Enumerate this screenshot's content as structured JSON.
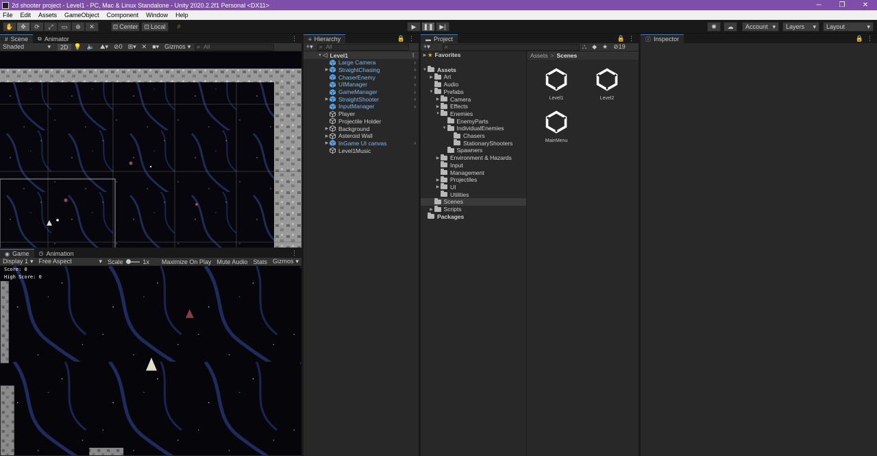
{
  "window": {
    "title": "2d shooter project - Level1 - PC, Mac & Linux Standalone - Unity 2020.2.2f1 Personal <DX11>",
    "controls": [
      "─",
      "❐",
      "✕"
    ]
  },
  "menu": [
    "File",
    "Edit",
    "Assets",
    "GameObject",
    "Component",
    "Window",
    "Help"
  ],
  "toolbar": {
    "tools": [
      "✋",
      "✥",
      "⟳",
      "⤢",
      "▭",
      "⊕",
      "✕"
    ],
    "pivot_label": "Center",
    "space_label": "Local",
    "snap_icon": "#",
    "play": "▶",
    "pause": "❚❚",
    "step": "▶|",
    "account_label": "Account",
    "layers_label": "Layers",
    "layout_label": "Layout"
  },
  "scene_panel": {
    "tabs": [
      "Scene",
      "Animator"
    ],
    "shading": "Shaded",
    "mode_2d": "2D",
    "fx_count": "0",
    "gizmos": "Gizmos",
    "search_placeholder": "All"
  },
  "game_panel": {
    "tabs": [
      "Game",
      "Animation"
    ],
    "display": "Display 1",
    "aspect": "Free Aspect",
    "scale_label": "Scale",
    "scale_value": "1x",
    "maximize": "Maximize On Play",
    "mute": "Mute Audio",
    "stats": "Stats",
    "gizmos": "Gizmos",
    "score_text": "Score: 0",
    "high_score_text": "High Score: 0"
  },
  "hierarchy": {
    "tab": "Hierarchy",
    "add": "+",
    "search_placeholder": "All",
    "scene_name": "Level1",
    "items": [
      {
        "label": "Large Camera",
        "prefab": true,
        "expandable": false,
        "chevron": true
      },
      {
        "label": "StraightChasing",
        "prefab": true,
        "expandable": true,
        "chevron": true
      },
      {
        "label": "ChaserEnemy",
        "prefab": true,
        "expandable": false,
        "chevron": true
      },
      {
        "label": "UIManager",
        "prefab": true,
        "expandable": false,
        "chevron": true
      },
      {
        "label": "GameManager",
        "prefab": true,
        "expandable": false,
        "chevron": true
      },
      {
        "label": "StraightShooter",
        "prefab": true,
        "expandable": true,
        "chevron": true
      },
      {
        "label": "InputManager",
        "prefab": true,
        "expandable": false,
        "chevron": true
      },
      {
        "label": "Player",
        "prefab": false,
        "expandable": false,
        "chevron": false
      },
      {
        "label": "Projectile Holder",
        "prefab": false,
        "expandable": false,
        "chevron": false
      },
      {
        "label": "Background",
        "prefab": false,
        "expandable": true,
        "chevron": false
      },
      {
        "label": "Asteroid Wall",
        "prefab": false,
        "expandable": true,
        "chevron": false
      },
      {
        "label": "InGame UI canvas",
        "prefab": true,
        "expandable": true,
        "chevron": true
      },
      {
        "label": "Level1Music",
        "prefab": false,
        "expandable": false,
        "chevron": false
      }
    ]
  },
  "project": {
    "tab": "Project",
    "add": "+",
    "hidden_count": "19",
    "favorites": "Favorites",
    "tree": [
      {
        "label": "Assets",
        "depth": 0,
        "arrow": "▼",
        "bold": true
      },
      {
        "label": "Art",
        "depth": 1,
        "arrow": "▶"
      },
      {
        "label": "Audio",
        "depth": 1,
        "arrow": ""
      },
      {
        "label": "Prefabs",
        "depth": 1,
        "arrow": "▼"
      },
      {
        "label": "Camera",
        "depth": 2,
        "arrow": "▶"
      },
      {
        "label": "Effects",
        "depth": 2,
        "arrow": "▶"
      },
      {
        "label": "Enemies",
        "depth": 2,
        "arrow": "▼"
      },
      {
        "label": "EnemyParts",
        "depth": 3,
        "arrow": ""
      },
      {
        "label": "IndividualEnemies",
        "depth": 3,
        "arrow": "▼"
      },
      {
        "label": "Chasers",
        "depth": 4,
        "arrow": ""
      },
      {
        "label": "StationaryShooters",
        "depth": 4,
        "arrow": ""
      },
      {
        "label": "Spawners",
        "depth": 3,
        "arrow": ""
      },
      {
        "label": "Environment & Hazards",
        "depth": 2,
        "arrow": "▶"
      },
      {
        "label": "Input",
        "depth": 2,
        "arrow": ""
      },
      {
        "label": "Management",
        "depth": 2,
        "arrow": ""
      },
      {
        "label": "Projectiles",
        "depth": 2,
        "arrow": "▶"
      },
      {
        "label": "UI",
        "depth": 2,
        "arrow": "▶"
      },
      {
        "label": "Utilities",
        "depth": 2,
        "arrow": ""
      },
      {
        "label": "Scenes",
        "depth": 1,
        "arrow": "",
        "selected": true
      },
      {
        "label": "Scripts",
        "depth": 1,
        "arrow": "▶"
      },
      {
        "label": "Packages",
        "depth": 0,
        "arrow": "",
        "bold": true
      }
    ],
    "breadcrumb": [
      "Assets",
      ">",
      "Scenes"
    ],
    "assets": [
      "Level1",
      "Level2",
      "MainMenu"
    ]
  },
  "inspector": {
    "tab": "Inspector"
  },
  "colors": {
    "title_bar": "#7d4fa8",
    "prefab_text": "#7cb7f0",
    "panel_bg": "#282828"
  }
}
